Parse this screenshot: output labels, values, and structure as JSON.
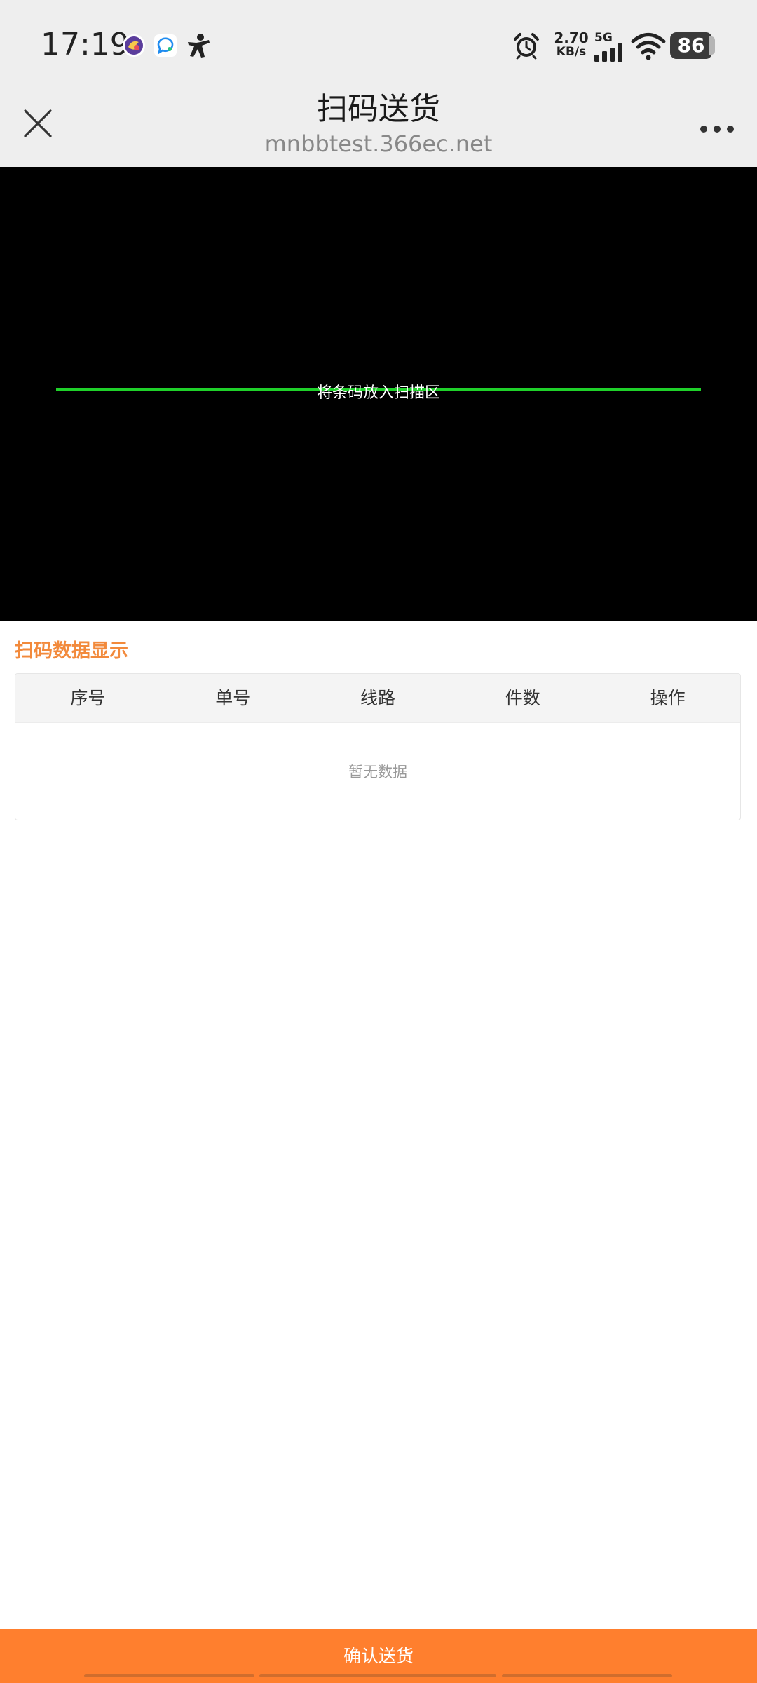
{
  "status_bar": {
    "time": "17:19",
    "net_speed_value": "2.70",
    "net_speed_unit": "KB/s",
    "signal_label": "5G",
    "battery_level": "86"
  },
  "nav": {
    "title": "扫码送货",
    "subtitle": "mnbbtest.366ec.net"
  },
  "scanner": {
    "hint": "将条码放入扫描区",
    "line_color": "#1fd12a"
  },
  "data_section": {
    "title": "扫码数据显示",
    "columns": [
      "序号",
      "单号",
      "线路",
      "件数",
      "操作"
    ],
    "rows": [],
    "empty_text": "暂无数据"
  },
  "footer": {
    "confirm_label": "确认送货"
  },
  "colors": {
    "accent": "#ff7f2e",
    "section_title": "#f28a3c",
    "bar_bg": "#eeeeee"
  }
}
